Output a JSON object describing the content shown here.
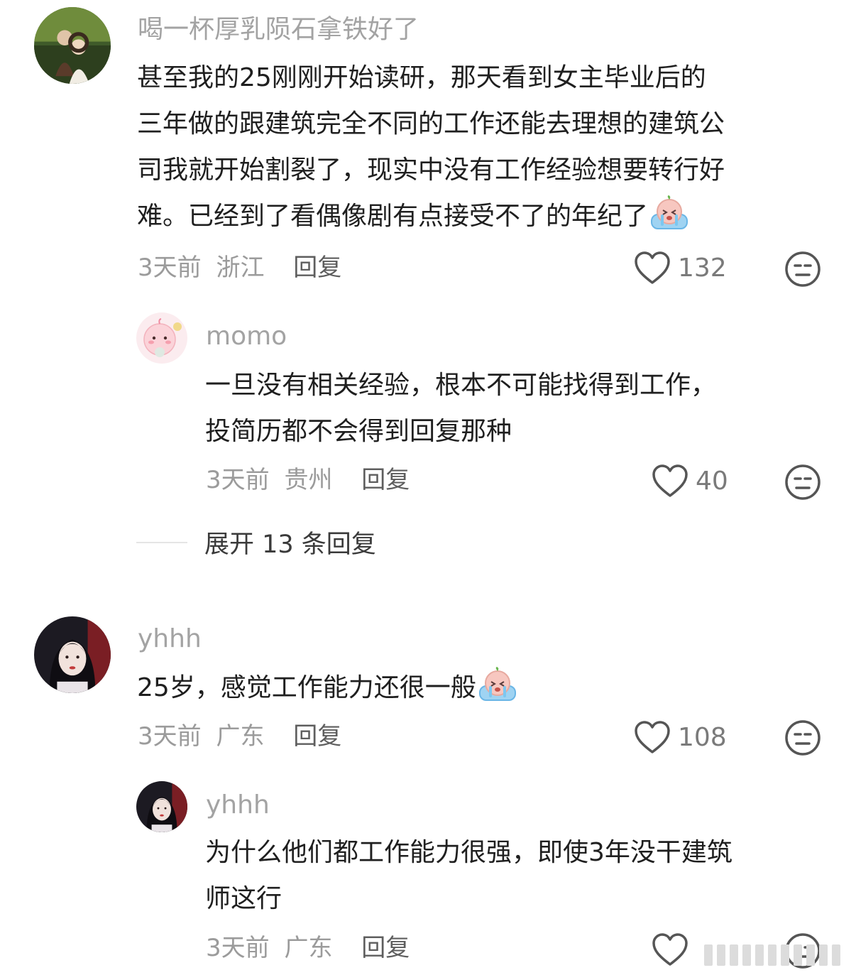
{
  "comments": [
    {
      "username": "喝一杯厚乳陨石拿铁好了",
      "lines": [
        "甚至我的25刚刚开始读研，那天看到女主毕业后的",
        "三年做的跟建筑完全不同的工作还能去理想的建筑公",
        "司我就开始割裂了，现实中没有工作经验想要转行好",
        "难。已经到了看偶像剧有点接受不了的年纪了"
      ],
      "time": "3天前",
      "location": "浙江",
      "reply_label": "回复",
      "likes": "132"
    },
    {
      "username": "momo",
      "lines": [
        "一旦没有相关经验，根本不可能找得到工作，",
        "投简历都不会得到回复那种"
      ],
      "time": "3天前",
      "location": "贵州",
      "reply_label": "回复",
      "likes": "40"
    },
    {
      "username": "yhhh",
      "lines": [
        "25岁，感觉工作能力还很一般"
      ],
      "time": "3天前",
      "location": "广东",
      "reply_label": "回复",
      "likes": "108"
    },
    {
      "username": "yhhh",
      "lines": [
        "为什么他们都工作能力很强，即使3年没干建筑",
        "师这行"
      ],
      "time": "3天前",
      "location": "广东",
      "reply_label": "回复",
      "likes": ""
    }
  ],
  "expand_replies": "展开 13 条回复",
  "icons": {
    "like": "heart-outline-icon",
    "dislike": "meh-face-icon",
    "emoji": "crying-face-emoji"
  },
  "colors": {
    "username": "#a3a3a3",
    "text": "#1f1f1f",
    "meta": "#9b9b9b",
    "icon": "#555555"
  }
}
